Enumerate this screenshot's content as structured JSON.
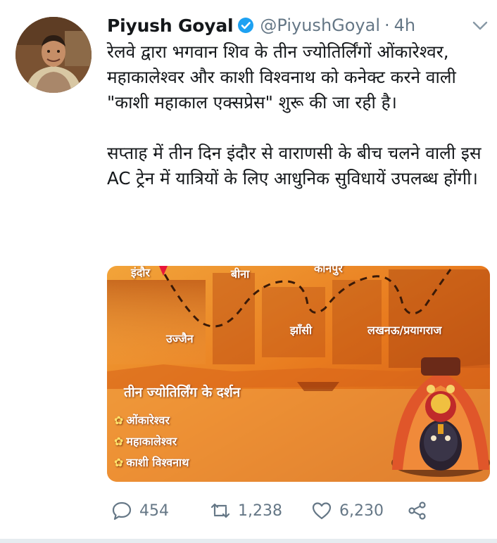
{
  "author": {
    "name": "Piyush Goyal",
    "handle": "@PiyushGoyal",
    "separator": "·",
    "time": "4h",
    "avatar_icon": "profile-photo",
    "verified_icon": "verified-badge-icon"
  },
  "tweet": {
    "paragraph1": "रेलवे द्वारा भगवान शिव के तीन ज्योतिर्लिंगों ओंकारेश्वर, महाकालेश्वर और काशी विश्वनाथ को कनेक्ट करने वाली \"काशी महाकाल एक्सप्रेस\" शुरू की जा रही है।",
    "paragraph2": "सप्ताह में तीन दिन इंदौर से वाराणसी के बीच चलने वाली इस AC ट्रेन में यात्रियों के लिए आधुनिक सुविधायें उपलब्ध होंगी।"
  },
  "media": {
    "stations": {
      "indore": "इंदौर",
      "ujjain": "उज्जैन",
      "bina": "बीना",
      "jhansi": "झाँसी",
      "kanpur": "कानपुर",
      "lucknow": "लखनऊ/प्रयागराज"
    },
    "darshan_title": "तीन ज्योतिर्लिंग के दर्शन",
    "jyotirlingas": [
      "ओंकारेश्वर",
      "महाकालेश्वर",
      "काशी विश्वनाथ"
    ]
  },
  "actions": {
    "reply_count": "454",
    "retweet_count": "1,238",
    "like_count": "6,230"
  },
  "colors": {
    "text": "#14171a",
    "secondary": "#657786",
    "verified": "#1da1f2",
    "media_orange": "#e8741c"
  }
}
